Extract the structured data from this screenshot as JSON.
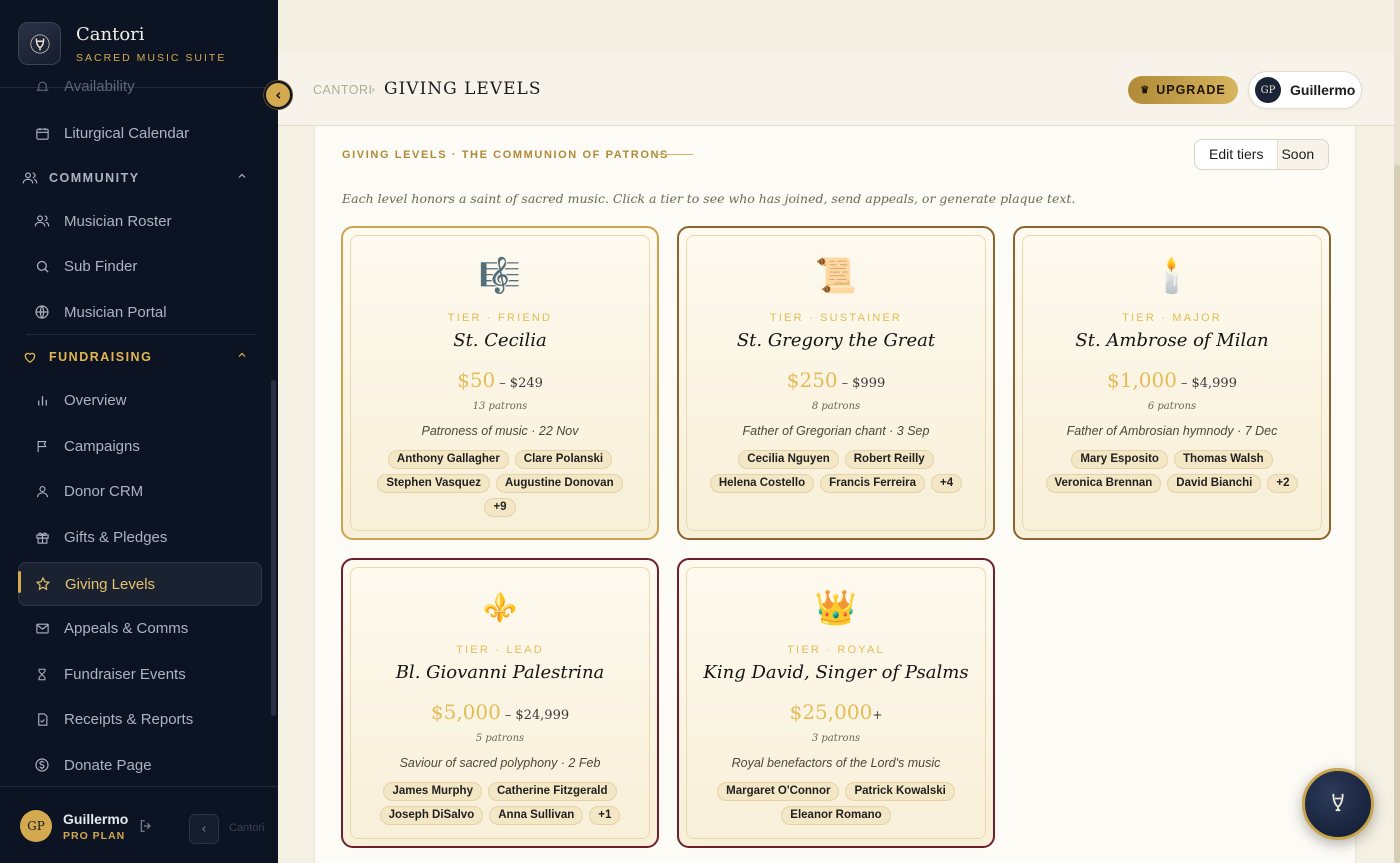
{
  "app": {
    "name": "Cantori",
    "tagline": "SACRED MUSIC SUITE"
  },
  "sidebar": {
    "items_top": [
      {
        "label": "Availability",
        "icon": "bell-icon"
      },
      {
        "label": "Liturgical Calendar",
        "icon": "calendar-icon"
      }
    ],
    "community": {
      "title": "COMMUNITY",
      "items": [
        {
          "label": "Musician Roster",
          "icon": "users-icon"
        },
        {
          "label": "Sub Finder",
          "icon": "search-icon"
        },
        {
          "label": "Musician Portal",
          "icon": "globe-icon"
        }
      ]
    },
    "fundraising": {
      "title": "FUNDRAISING",
      "items": [
        {
          "label": "Overview",
          "icon": "bar-chart-icon"
        },
        {
          "label": "Campaigns",
          "icon": "flag-icon"
        },
        {
          "label": "Donor CRM",
          "icon": "user-icon"
        },
        {
          "label": "Gifts & Pledges",
          "icon": "gift-icon"
        },
        {
          "label": "Giving Levels",
          "icon": "star-icon",
          "active": true
        },
        {
          "label": "Appeals & Comms",
          "icon": "mail-icon"
        },
        {
          "label": "Fundraiser Events",
          "icon": "hourglass-icon"
        },
        {
          "label": "Receipts & Reports",
          "icon": "receipt-icon"
        },
        {
          "label": "Donate Page",
          "icon": "dollar-icon"
        }
      ]
    },
    "footer": {
      "initials": "GP",
      "user": "Guillermo",
      "plan": "PRO PLAN",
      "mini_label": "Cantori"
    }
  },
  "header": {
    "breadcrumb_root": "CANTORI",
    "breadcrumb_sep": "›",
    "breadcrumb_current": "GIVING LEVELS",
    "upgrade_label": "UPGRADE",
    "user_initials": "GP",
    "user_name": "Guillermo"
  },
  "panel": {
    "title": "GIVING LEVELS · THE COMMUNION OF PATRONS",
    "subtitle": "Each level honors a saint of sacred music. Click a tier to see who has joined, send appeals, or generate plaque text.",
    "edit_label": "Edit tiers",
    "soon_label": "Soon"
  },
  "tiers": [
    {
      "emoji": "🎼",
      "tier": "TIER · FRIEND",
      "saint": "St. Cecilia",
      "price_low": "$50",
      "price_dash": "–",
      "price_high": "$249",
      "patrons": "13 patrons",
      "desc": "Patroness of music · 22 Nov",
      "chips": [
        "Anthony Gallagher",
        "Clare Polanski",
        "Stephen Vasquez",
        "Augustine Donovan",
        "+9"
      ]
    },
    {
      "emoji": "📜",
      "tier": "TIER · SUSTAINER",
      "saint": "St. Gregory the Great",
      "price_low": "$250",
      "price_dash": "–",
      "price_high": "$999",
      "patrons": "8 patrons",
      "desc": "Father of Gregorian chant · 3 Sep",
      "chips": [
        "Cecilia Nguyen",
        "Robert Reilly",
        "Helena Costello",
        "Francis Ferreira",
        "+4"
      ]
    },
    {
      "emoji": "🕯️",
      "tier": "TIER · MAJOR",
      "saint": "St. Ambrose of Milan",
      "price_low": "$1,000",
      "price_dash": "–",
      "price_high": "$4,999",
      "patrons": "6 patrons",
      "desc": "Father of Ambrosian hymnody · 7 Dec",
      "chips": [
        "Mary Esposito",
        "Thomas Walsh",
        "Veronica Brennan",
        "David Bianchi",
        "+2"
      ]
    },
    {
      "emoji": "⚜️",
      "tier": "TIER · LEAD",
      "saint": "Bl. Giovanni Palestrina",
      "price_low": "$5,000",
      "price_dash": "–",
      "price_high": "$24,999",
      "patrons": "5 patrons",
      "desc": "Saviour of sacred polyphony · 2 Feb",
      "chips": [
        "James Murphy",
        "Catherine Fitzgerald",
        "Joseph DiSalvo",
        "Anna Sullivan",
        "+1"
      ]
    },
    {
      "emoji": "👑",
      "tier": "TIER · ROYAL",
      "saint": "King David, Singer of Psalms",
      "price_low": "$25,000",
      "price_plus": "+",
      "patrons": "3 patrons",
      "desc": "Royal benefactors of the Lord's music",
      "chips": [
        "Margaret O'Connor",
        "Patrick Kowalski",
        "Eleanor Romano"
      ]
    }
  ],
  "colors": {
    "sidebar_bg": "#0c1322",
    "accent_gold": "#d4aa50",
    "card_border_gold": "#c9a44c",
    "card_border_bronze": "#8b6430",
    "card_border_wine": "#6d1f2a"
  }
}
